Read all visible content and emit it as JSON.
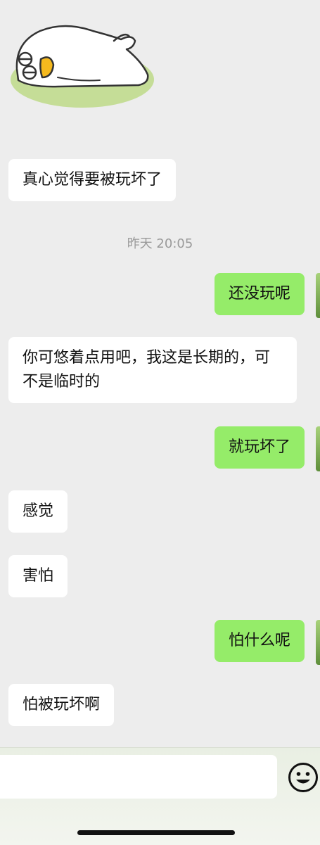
{
  "conversation": {
    "timestamp": "昨天 20:05",
    "messages": [
      {
        "side": "in",
        "text": "真心觉得要被玩坏了"
      },
      {
        "side": "out",
        "text": "还没玩呢"
      },
      {
        "side": "in",
        "text": "你可悠着点用吧，我这是长期的，可不是临时的"
      },
      {
        "side": "out",
        "text": "就玩坏了"
      },
      {
        "side": "in",
        "text": "感觉"
      },
      {
        "side": "in",
        "text": "害怕"
      },
      {
        "side": "out",
        "text": "怕什么呢"
      },
      {
        "side": "in",
        "text": "怕被玩坏啊"
      }
    ]
  },
  "input_bar": {
    "placeholder": ""
  },
  "icons": {
    "sticker": "lying-duck-sticker",
    "emoji": "smiley-face-icon"
  },
  "colors": {
    "background": "#ededed",
    "incoming_bubble": "#ffffff",
    "outgoing_bubble": "#95ec69",
    "timestamp_text": "#9a9a9a"
  }
}
